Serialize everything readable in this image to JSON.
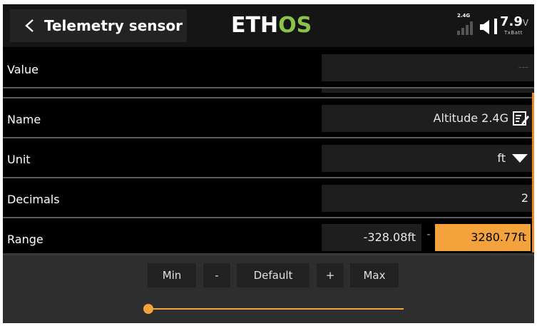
{
  "header": {
    "title": "Telemetry sensor",
    "logo_part1": "ETH",
    "logo_part2": "OS",
    "rf_label": "2.4G",
    "voltage": "7.9",
    "voltage_unit": "V",
    "voltage_label": "TxBatt"
  },
  "rows": {
    "value": {
      "label": "Value",
      "field": "---"
    },
    "name": {
      "label": "Name",
      "field": "Altitude 2.4G"
    },
    "unit": {
      "label": "Unit",
      "field": "ft"
    },
    "decimals": {
      "label": "Decimals",
      "field": "2"
    },
    "range": {
      "label": "Range",
      "min": "-328.08ft",
      "sep": "-",
      "max": "3280.77ft"
    }
  },
  "bottom_bar": {
    "min_label": "Min",
    "minus_label": "-",
    "default_label": "Default",
    "plus_label": "+",
    "max_label": "Max",
    "slider_fraction": 0.0
  },
  "colors": {
    "accent": "#f4a23c",
    "logo_green": "#8bc34a",
    "background": "#000000"
  },
  "icons": {
    "back": "chevron-left-icon",
    "edit": "edit-icon",
    "dropdown": "triangle-down-icon",
    "signal": "signal-bars-icon",
    "speaker": "speaker-icon"
  }
}
